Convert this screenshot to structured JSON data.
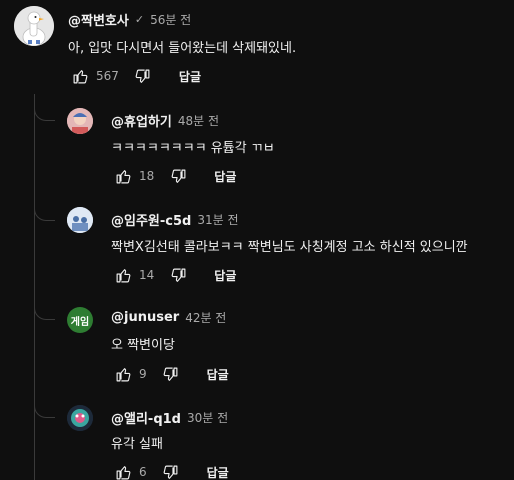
{
  "comment": {
    "author": "@짝변호사",
    "verified_icon": "check-icon",
    "time": "56분 전",
    "text": "아, 입맛 다시면서 들어왔는데 삭제돼있네.",
    "likes": "567",
    "reply_label": "답글"
  },
  "replies": [
    {
      "author": "@휴업하기",
      "time": "48분 전",
      "text": "ㅋㅋㅋㅋㅋㅋㅋㅋ 유튭각 ㄲㅂ",
      "likes": "18",
      "reply_label": "답글",
      "avatar_color": "#6a8fc7"
    },
    {
      "author": "@임주원-c5d",
      "time": "31분 전",
      "text": "짝변X김선태 콜라보ㅋㅋ 짝변님도 사칭계정 고소 하신적 있으니깐",
      "likes": "14",
      "reply_label": "답글",
      "avatar_color": "#9fb6d9"
    },
    {
      "author": "@junuser",
      "time": "42분 전",
      "text": "오 짝변이당",
      "likes": "9",
      "reply_label": "답글",
      "avatar_text": "게임",
      "avatar_color": "#2e7d32"
    },
    {
      "author": "@앨리-q1d",
      "time": "30분 전",
      "text": "유각 실패",
      "likes": "6",
      "reply_label": "답글",
      "avatar_color": "#3aa6a0"
    }
  ]
}
